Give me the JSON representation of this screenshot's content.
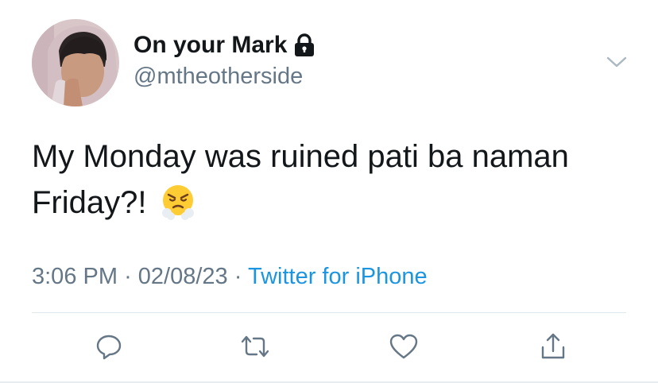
{
  "user": {
    "display_name": "On your Mark",
    "handle": "@mtheotherside",
    "protected_icon": "lock-icon"
  },
  "tweet": {
    "text": "My Monday was ruined pati ba naman Friday?!",
    "emoji": "face-with-steam-from-nose"
  },
  "meta": {
    "time": "3:06 PM",
    "separator": "·",
    "date": "02/08/23",
    "source": "Twitter for iPhone"
  },
  "actions": [
    {
      "name": "reply",
      "icon": "reply-icon"
    },
    {
      "name": "retweet",
      "icon": "retweet-icon"
    },
    {
      "name": "like",
      "icon": "heart-icon"
    },
    {
      "name": "share",
      "icon": "share-icon"
    }
  ],
  "colors": {
    "text": "#14171a",
    "secondary": "#657786",
    "link": "#1b95e0",
    "divider": "#e1e8ed"
  }
}
